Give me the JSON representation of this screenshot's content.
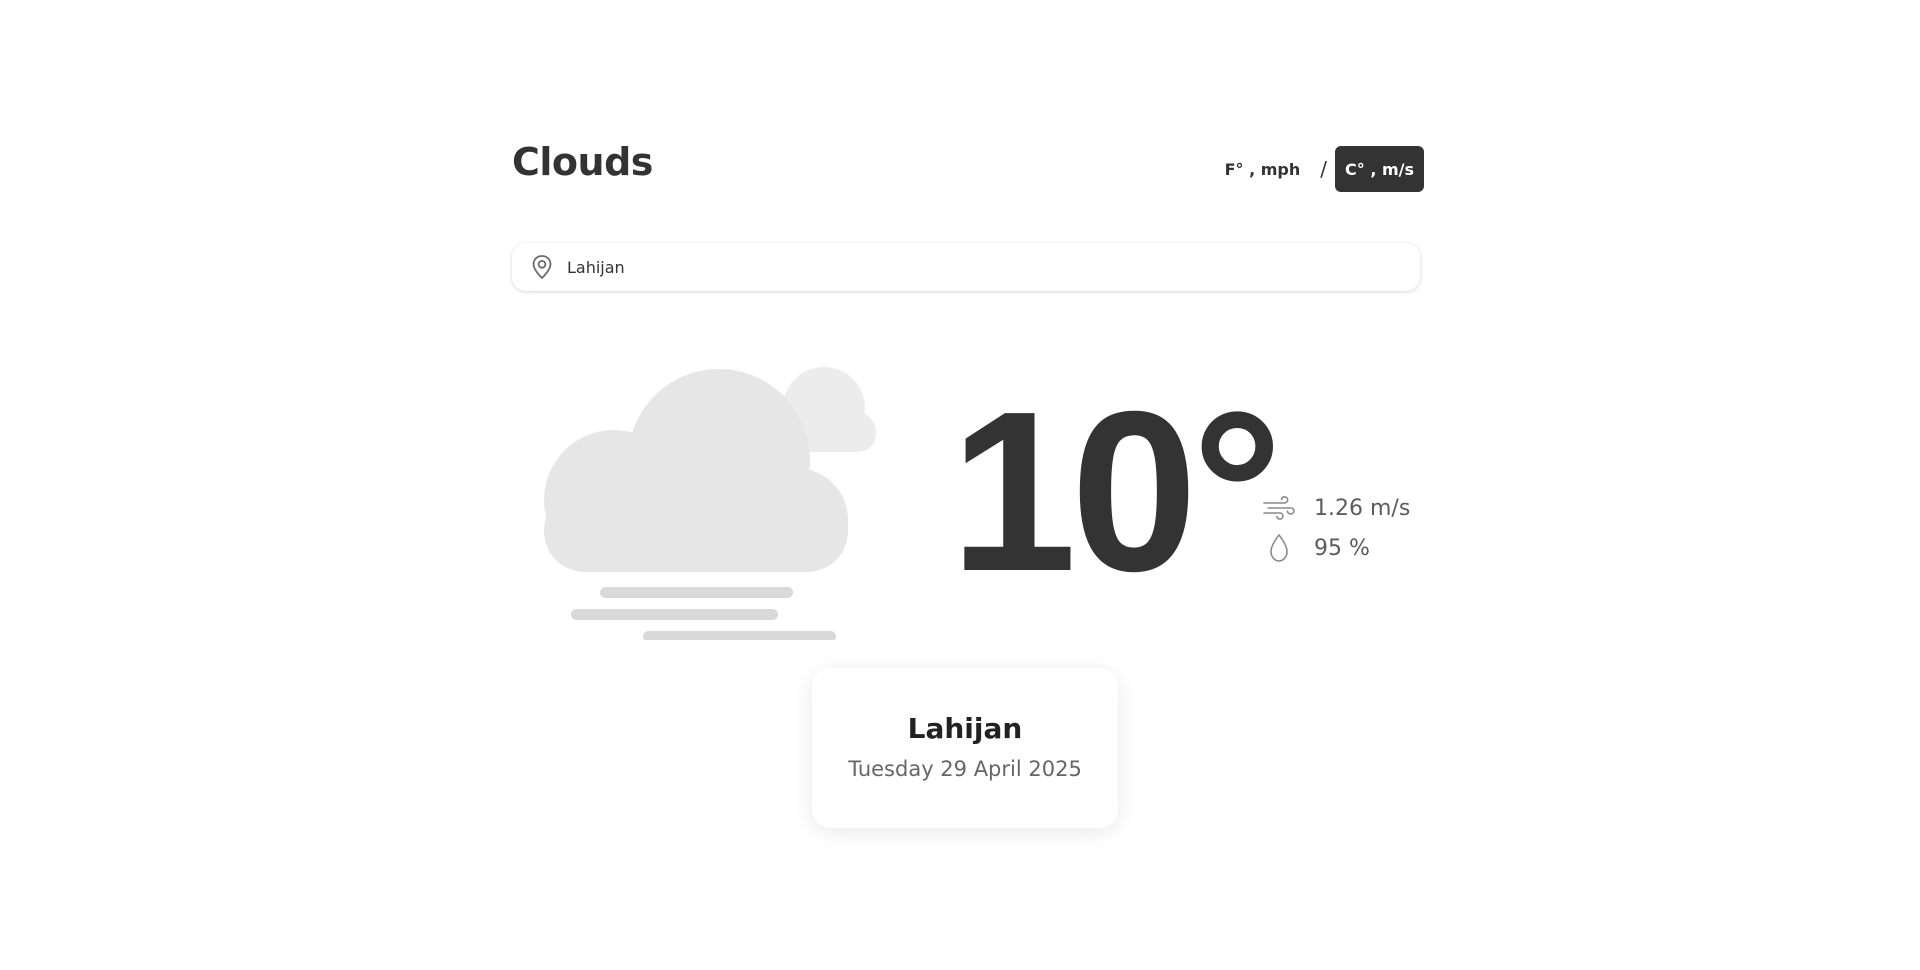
{
  "header": {
    "title": "Clouds"
  },
  "units": {
    "imperial_label": "F° , mph",
    "separator": "/",
    "metric_label": "C° , m/s",
    "selected": "metric"
  },
  "search": {
    "value": "Lahijan",
    "icon": "location-pin-icon"
  },
  "weather": {
    "condition_icon": "clouds-fog-icon",
    "temperature": "10°",
    "wind_speed": "1.26 m/s",
    "wind_icon": "wind-icon",
    "humidity": "95 %",
    "humidity_icon": "droplet-icon"
  },
  "location_card": {
    "city": "Lahijan",
    "date": "Tuesday 29 April 2025"
  },
  "colors": {
    "text_primary": "#333333",
    "text_secondary": "#666666",
    "active_button_bg": "#333333",
    "cloud_fill": "#e8e8e8",
    "fog_fill": "#d9d9d9"
  }
}
